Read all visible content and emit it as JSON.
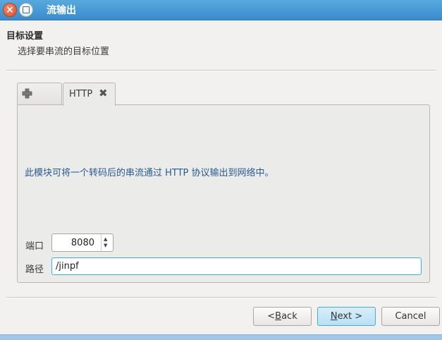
{
  "window": {
    "title": "流输出"
  },
  "header": {
    "title": "目标设置",
    "subtitle": "选择要串流的目标位置"
  },
  "tabs": [
    {
      "label": "",
      "icon": "plus-icon"
    },
    {
      "label": "HTTP",
      "close_icon": "close-x-icon"
    }
  ],
  "panel": {
    "description": "此模块可将一个转码后的串流通过 HTTP 协议输出到网络中。",
    "port_label": "端口",
    "port_value": "8080",
    "path_label": "路径",
    "path_value": "/jinpf"
  },
  "buttons": {
    "back_pre": "< ",
    "back_key": "B",
    "back_post": "ack",
    "next_key": "N",
    "next_post": "ext >",
    "cancel": "Cancel"
  },
  "colors": {
    "titlebar": "#3a8bcc",
    "accent_text": "#2a5a8f",
    "focus_border": "#3cb1c9"
  }
}
